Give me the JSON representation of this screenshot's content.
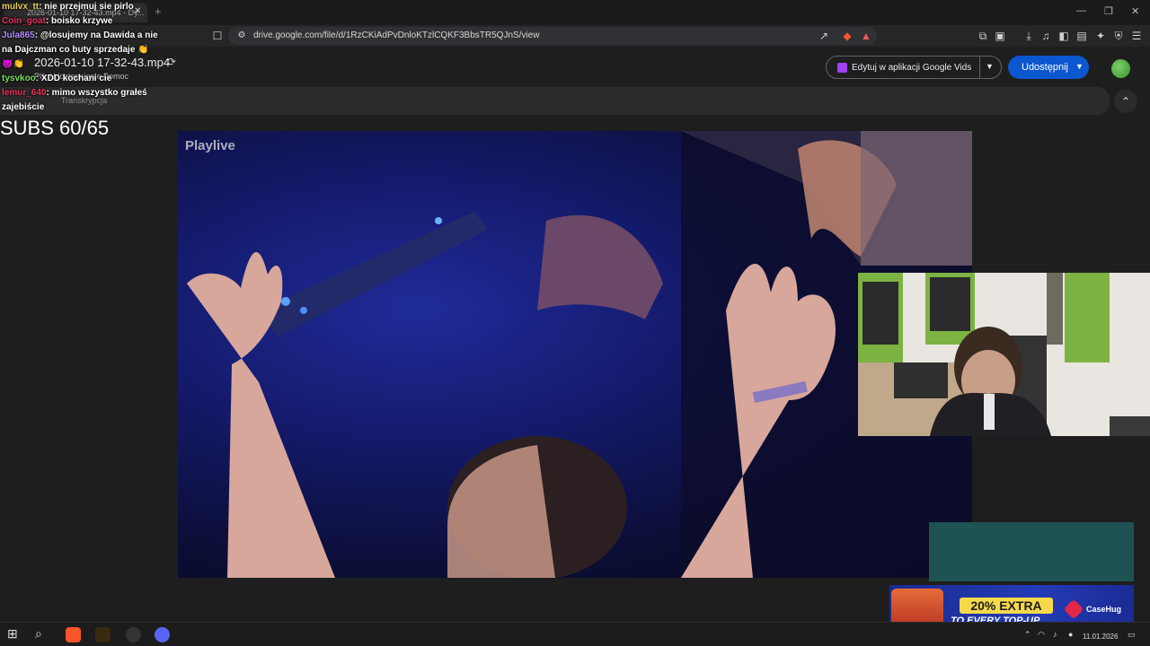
{
  "browser": {
    "tab_title": "2026-01-10 17-32-43.mp4 - Dy...",
    "tab_close": "✕",
    "new_tab": "+",
    "url": "drive.google.com/file/d/1RzCKiAdPvDnloKTzlCQKF3BbsTR5QJnS/view",
    "window_controls": [
      "—",
      "❐",
      "✕"
    ]
  },
  "drive": {
    "file_name": "2026-01-10 17-32-43.mp4",
    "menu": "Plik   Udostępnianie   Pomoc",
    "edit_button": "Edytuj w aplikacji Google Vids",
    "share_button": "Udostępnij",
    "transcript_label": "Transkrypcja"
  },
  "overlay": {
    "subs_counter": "SUBS 60/65",
    "chat": [
      {
        "user": "mulvx_tt",
        "user_color": "#e9d05a",
        "message": "nie przejmuj sie pirlo"
      },
      {
        "user": "Coin_goat",
        "user_color": "#e8335a",
        "message": "boisko krzywe"
      },
      {
        "user": "Jula865",
        "user_color": "#b48cff",
        "message": "@losujemy na Dawida a nie na Dajczman co buty sprzedaje 👏😈👏"
      },
      {
        "user": "tysvkoo",
        "user_color": "#7ae05c",
        "message": "XDD kochani cie"
      },
      {
        "user": "lemur_640",
        "user_color": "#e8335a",
        "message": "mimo wszystko grałeś zajebiście"
      }
    ]
  },
  "video": {
    "watermark": "Playlive"
  },
  "ad": {
    "headline": "20% EXTRA",
    "subline": "TO EVERY TOP-UP",
    "brand": "CaseHug"
  },
  "taskbar": {
    "date": "11.01.2026"
  },
  "colors": {
    "share": "#0b57d0",
    "vids": "#a142f4",
    "teal_box": "#1e5253"
  }
}
